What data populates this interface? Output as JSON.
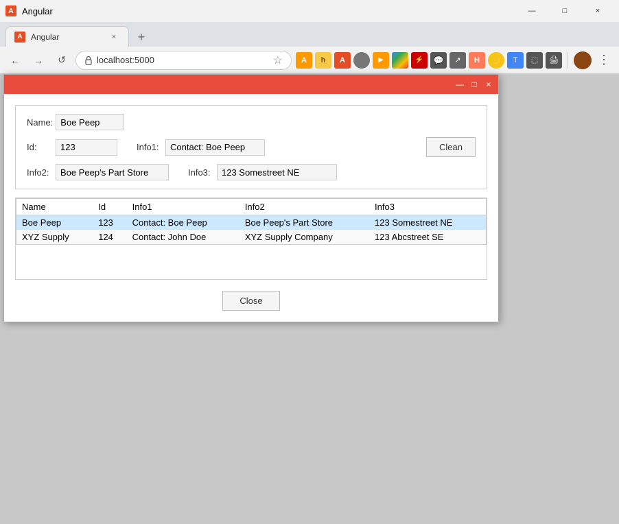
{
  "browser": {
    "tab": {
      "favicon": "A",
      "title": "Angular",
      "close": "×"
    },
    "new_tab_label": "+",
    "address": "localhost:5000",
    "nav": {
      "back": "←",
      "forward": "→",
      "refresh": "↺"
    },
    "window_controls": {
      "minimize": "—",
      "maximize": "□",
      "close": "×"
    }
  },
  "dialog": {
    "titlebar": {
      "minimize": "—",
      "maximize": "□",
      "close": "×"
    },
    "form": {
      "name_label": "Name:",
      "name_value": "Boe Peep",
      "id_label": "Id:",
      "id_value": "123",
      "info1_label": "Info1:",
      "info1_value": "Contact: Boe Peep",
      "info2_label": "Info2:",
      "info2_value": "Boe Peep's Part Store",
      "info3_label": "Info3:",
      "info3_value": "123 Somestreet NE",
      "clean_button": "Clean"
    },
    "table": {
      "headers": [
        "Name",
        "Id",
        "Info1",
        "Info2",
        "Info3"
      ],
      "rows": [
        {
          "name": "Boe Peep",
          "id": "123",
          "info1": "Contact: Boe Peep",
          "info2": "Boe Peep's Part Store",
          "info3": "123 Somestreet NE"
        },
        {
          "name": "XYZ Supply",
          "id": "124",
          "info1": "Contact: John Doe",
          "info2": "XYZ Supply Company",
          "info3": "123 Abcstreet SE"
        }
      ]
    },
    "close_button": "Close"
  }
}
